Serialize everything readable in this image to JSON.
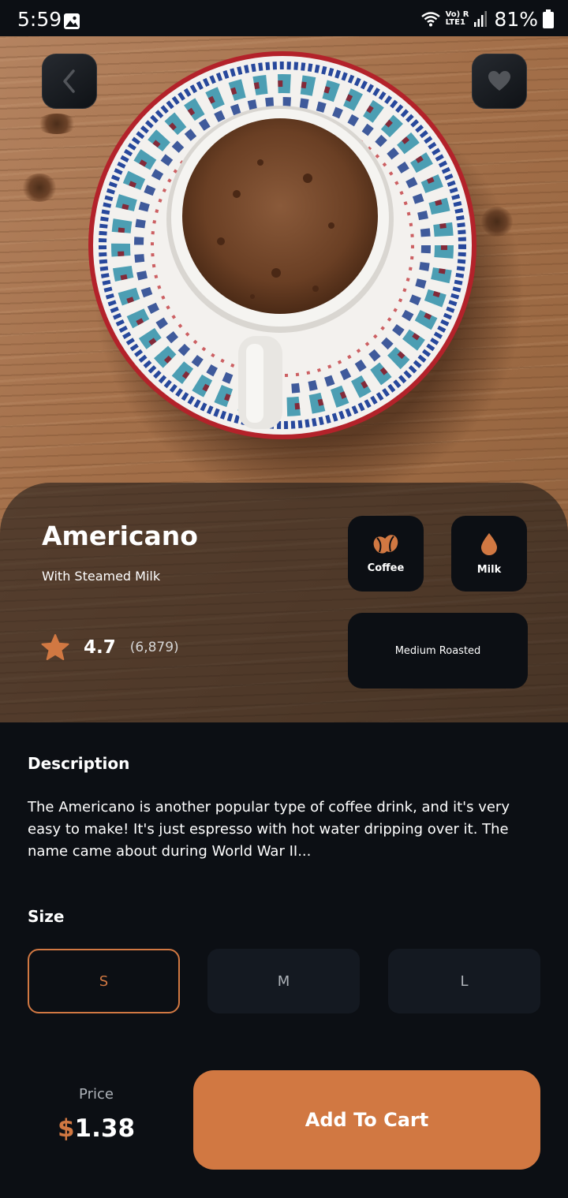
{
  "status_bar": {
    "time": "5:59",
    "network_top": "Vo) R",
    "network_bottom": "LTE1",
    "battery": "81%"
  },
  "product": {
    "name": "Americano",
    "subtitle": "With Steamed Milk",
    "rating": "4.7",
    "rating_count": "(6,879)"
  },
  "chips": {
    "coffee": "Coffee",
    "milk": "Milk",
    "roast": "Medium Roasted"
  },
  "description": {
    "title": "Description",
    "text": "The Americano is another popular type of coffee drink, and it's very easy to make! It's just espresso with hot water dripping over it. The name came about during World War II..."
  },
  "size": {
    "title": "Size",
    "options": [
      "S",
      "M",
      "L"
    ],
    "selected": "S"
  },
  "price": {
    "label": "Price",
    "currency": "$",
    "amount": "1.38"
  },
  "cart_button": "Add To Cart",
  "colors": {
    "accent": "#D17842",
    "background": "#0C0F14",
    "card": "#141921"
  },
  "icons": [
    "gallery-icon",
    "wifi-icon",
    "signal-icon",
    "battery-icon",
    "back-arrow-icon",
    "heart-icon",
    "coffee-beans-icon",
    "milk-drop-icon",
    "star-icon"
  ]
}
